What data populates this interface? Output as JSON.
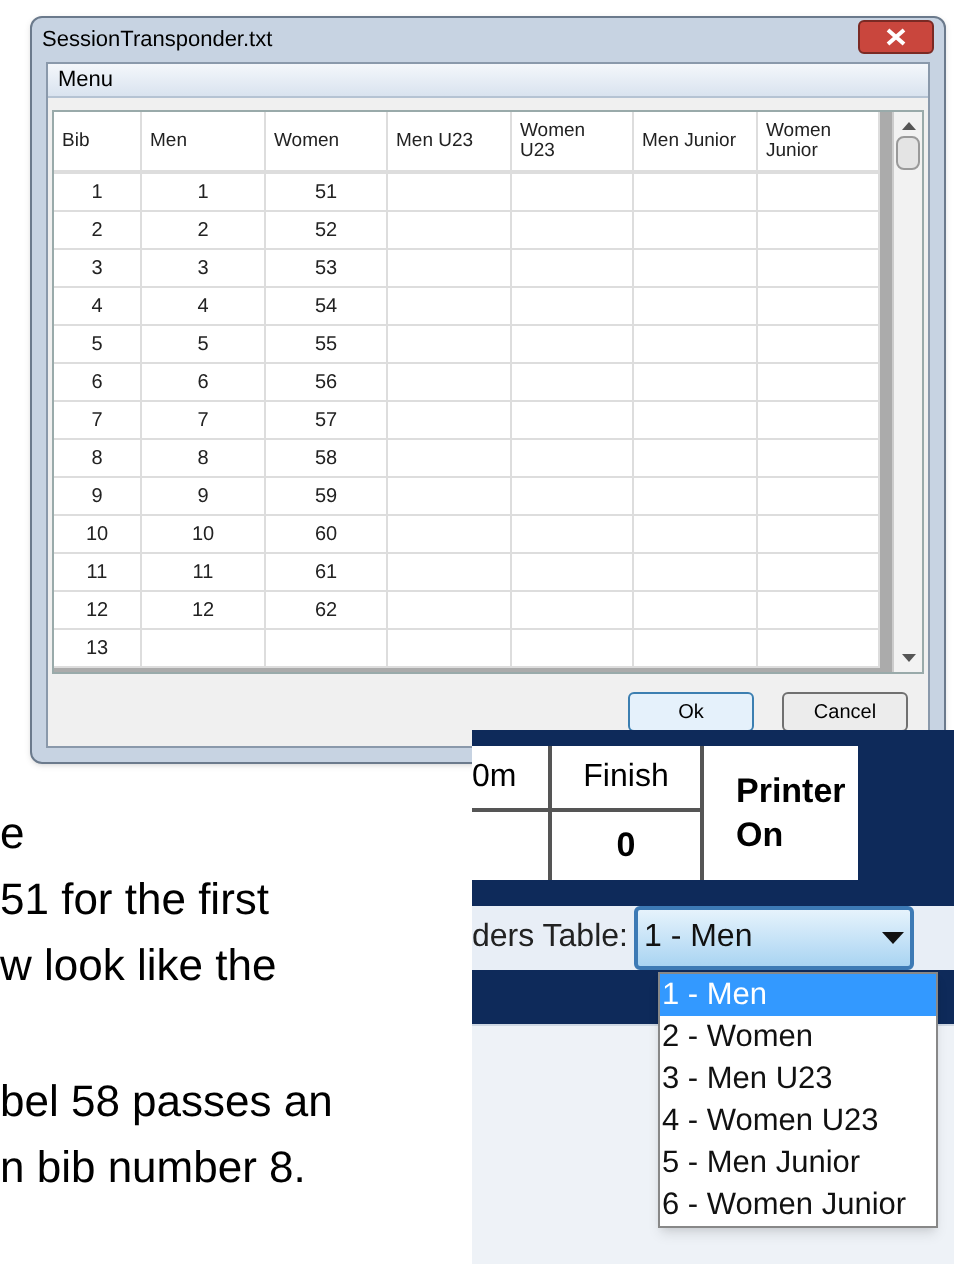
{
  "dialog": {
    "title": "SessionTransponder.txt",
    "menu": [
      "Menu"
    ],
    "columns": [
      "Bib",
      "Men",
      "Women",
      "Men U23",
      "Women U23",
      "Men Junior",
      "Women Junior"
    ],
    "rows": [
      {
        "bib": "1",
        "men": "1",
        "women": "51"
      },
      {
        "bib": "2",
        "men": "2",
        "women": "52"
      },
      {
        "bib": "3",
        "men": "3",
        "women": "53"
      },
      {
        "bib": "4",
        "men": "4",
        "women": "54"
      },
      {
        "bib": "5",
        "men": "5",
        "women": "55"
      },
      {
        "bib": "6",
        "men": "6",
        "women": "56"
      },
      {
        "bib": "7",
        "men": "7",
        "women": "57"
      },
      {
        "bib": "8",
        "men": "8",
        "women": "58"
      },
      {
        "bib": "9",
        "men": "9",
        "women": "59"
      },
      {
        "bib": "10",
        "men": "10",
        "women": "60"
      },
      {
        "bib": "11",
        "men": "11",
        "women": "61"
      },
      {
        "bib": "12",
        "men": "12",
        "women": "62"
      },
      {
        "bib": "13"
      }
    ],
    "buttons": [
      "Ok",
      "Cancel"
    ]
  },
  "document_text": [
    "e",
    "51 for the first",
    "w look like the",
    "bel 58 passes an",
    "n bib number 8."
  ],
  "race_panel": {
    "columns": [
      {
        "header": "0m"
      },
      {
        "header": "Finish",
        "value": "0"
      }
    ],
    "printer_button": "Printer On",
    "table_label": "ders Table:",
    "dropdown": {
      "value": "1 - Men",
      "options": [
        {
          "label": "1 - Men",
          "selected": true
        },
        {
          "label": "2 - Women",
          "selected": false
        },
        {
          "label": "3 - Men U23",
          "selected": false
        },
        {
          "label": "4 - Women U23",
          "selected": false
        },
        {
          "label": "5 - Men Junior",
          "selected": false
        },
        {
          "label": "6 - Women Junior",
          "selected": false
        }
      ]
    }
  }
}
